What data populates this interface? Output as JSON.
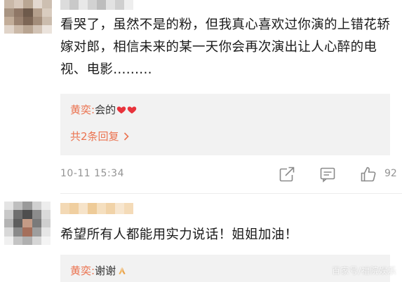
{
  "comments": [
    {
      "text": "看哭了，虽然不是的粉，但我真心喜欢过你演的上错花轿嫁对郎，相信未来的某一天你会再次演出让人心醉的电视、电影.........",
      "reply": {
        "author": "黄奕",
        "colon": ":",
        "text": "会的"
      },
      "more_replies": "共2条回复",
      "time": "10-11 15:34",
      "like_count": "92"
    },
    {
      "text": "希望所有人都能用实力说话！姐姐加油！",
      "reply": {
        "author": "黄奕",
        "colon": ":",
        "text": "谢谢"
      }
    }
  ],
  "icons": {
    "share": "share-icon",
    "comment": "comment-icon",
    "like": "like-icon",
    "more_chevron": "chevron-right-icon",
    "heart": "heart-icon",
    "pray": "praying-hands-icon"
  },
  "watermark": "百家号/福院娱乐",
  "colors": {
    "accent": "#eb7350",
    "meta": "#939393",
    "reply_bg": "#f2f2f2",
    "heart": "#e8333c"
  }
}
